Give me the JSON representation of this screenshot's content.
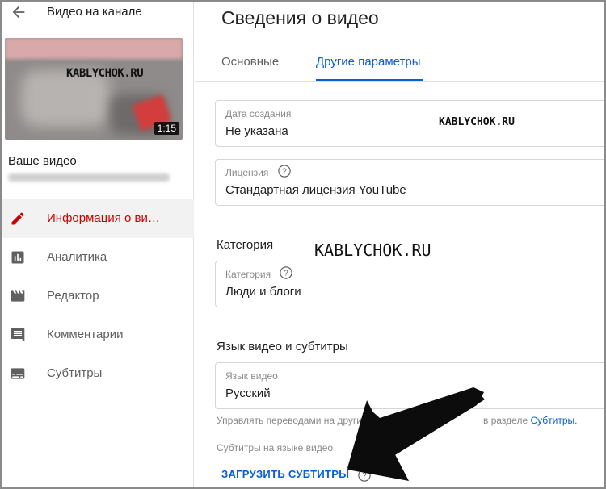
{
  "sidebar": {
    "back_title": "Видео на канале",
    "thumbnail": {
      "watermark": "KABLYCHOK.RU",
      "duration": "1:15"
    },
    "your_video": "Ваше видео",
    "nav": [
      {
        "label": "Информация о ви…",
        "icon": "pencil-icon",
        "active": true
      },
      {
        "label": "Аналитика",
        "icon": "analytics-icon",
        "active": false
      },
      {
        "label": "Редактор",
        "icon": "clapperboard-icon",
        "active": false
      },
      {
        "label": "Комментарии",
        "icon": "comment-icon",
        "active": false
      },
      {
        "label": "Субтитры",
        "icon": "subtitles-icon",
        "active": false
      }
    ]
  },
  "main": {
    "title": "Сведения о видео",
    "tabs": [
      "Основные",
      "Другие параметры"
    ],
    "active_tab": 1,
    "recording_date": {
      "label": "Дата создания",
      "value": "Не указана"
    },
    "license": {
      "label": "Лицензия",
      "value": "Стандартная лицензия YouTube"
    },
    "category_section": "Категория",
    "category": {
      "label": "Категория",
      "value": "Люди и блоги"
    },
    "language_section": "Язык видео и субтитры",
    "video_language": {
      "label": "Язык видео",
      "value": "Русский"
    },
    "manage_text_before": "Управлять переводами на други",
    "manage_text_after": "в разделе",
    "manage_link": "Субтитры.",
    "subtitles_language_label": "Субтитры на языке видео",
    "upload_subtitles": "ЗАГРУЗИТЬ СУБТИТРЫ"
  },
  "watermarks": {
    "top": "KABLYCHOK.RU",
    "middle": "KABLYCHOK.RU"
  },
  "colors": {
    "accent_blue": "#065fd4",
    "active_red": "#cc0000",
    "active_bg": "#f2f2f2"
  }
}
